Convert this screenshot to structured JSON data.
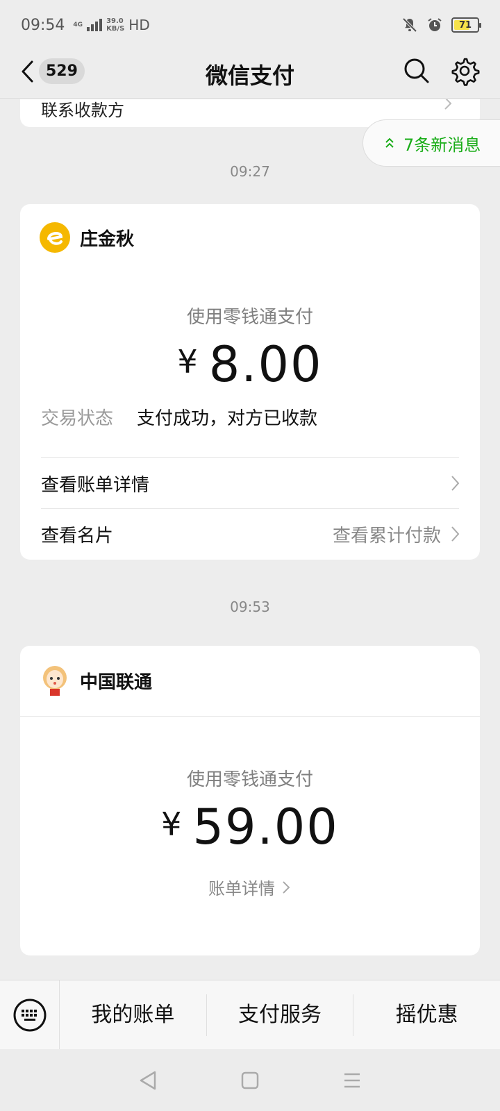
{
  "status_bar": {
    "time": "09:54",
    "network": "4G",
    "speed_top": "39.0",
    "speed_unit": "KB/S",
    "hd": "HD",
    "battery": "71",
    "battery_level_percent": 71,
    "battery_color": "#f6e24a"
  },
  "nav": {
    "back_icon": "chevron-left-icon",
    "unread_count": "529",
    "title": "微信支付",
    "search_icon": "search-icon",
    "settings_icon": "gear-icon"
  },
  "partial_card": {
    "text": "联系收款方"
  },
  "new_messages": {
    "label": "7条新消息",
    "icon": "double-chevron-up-icon",
    "color": "#1aad19"
  },
  "messages": [
    {
      "time": "09:27",
      "merchant": "庄金秋",
      "pay_method": "使用零钱通支付",
      "currency": "¥",
      "amount": "8.00",
      "status_label": "交易状态",
      "status_value": "支付成功，对方已收款",
      "bill_detail": "查看账单详情",
      "view_card": "查看名片",
      "view_total": "查看累计付款"
    },
    {
      "time": "09:53",
      "merchant": "中国联通",
      "pay_method": "使用零钱通支付",
      "currency": "¥",
      "amount": "59.00",
      "bill_link": "账单详情"
    }
  ],
  "bottom_menu": {
    "keyboard_icon": "keyboard-icon",
    "items": [
      "我的账单",
      "支付服务",
      "摇优惠"
    ]
  },
  "system_nav": {
    "back": "triangle-back-icon",
    "home": "square-home-icon",
    "menu": "menu-lines-icon"
  }
}
